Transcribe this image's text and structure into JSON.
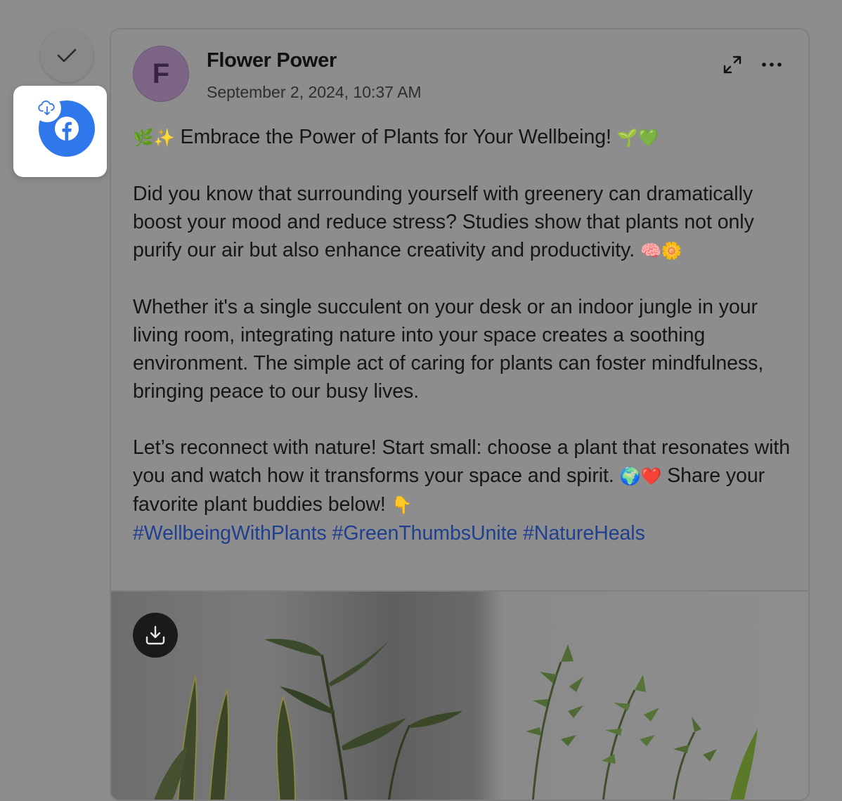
{
  "sidebar": {
    "check_icon": "check-icon",
    "platform_icon": "facebook-icon",
    "badge_icon": "cloud-upload-icon"
  },
  "post": {
    "author": "Flower Power",
    "avatar_initial": "F",
    "timestamp": "September 2, 2024, 10:37 AM",
    "paragraphs": [
      {
        "pre": "🌿✨",
        "text": " Embrace the Power of Plants for Your Wellbeing! ",
        "post": "🌱💚"
      },
      {
        "text": "Did you know that surrounding yourself with greenery can dramatically boost your mood and reduce stress? Studies show that plants not only purify our air but also enhance creativity and productivity. ",
        "post": "🧠🌼"
      },
      {
        "text": "Whether it's a single succulent on your desk or an indoor jungle in your living room, integrating nature into your space creates a soothing environment. The simple act of caring for plants can foster mindfulness, bringing peace to our busy lives."
      },
      {
        "text": "Let’s reconnect with nature! Start small: choose a plant that resonates with you and watch how it transforms your space and spirit. ",
        "mid": "🌍❤️",
        "text2": " Share your favorite plant buddies below! ",
        "post": "👇"
      }
    ],
    "hashtags": "#WellbeingWithPlants #GreenThumbsUnite #NatureHeals",
    "colors": {
      "hashtag": "#1f3f90",
      "facebook": "#2f78ec",
      "avatar": "#7d6585"
    }
  }
}
